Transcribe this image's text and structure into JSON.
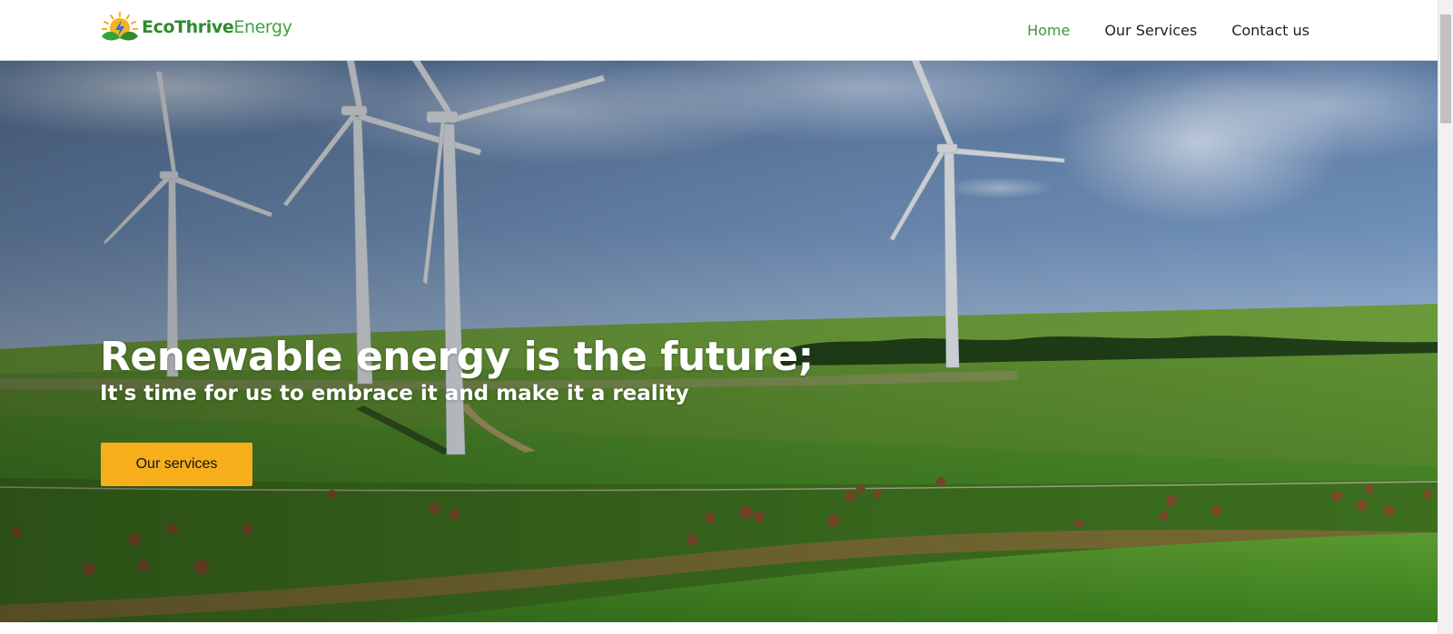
{
  "brand": {
    "name_bold": "EcoThrive",
    "name_light": "Energy",
    "colors": {
      "green": "#2e8b2e",
      "sun": "#f5b321",
      "bolt": "#2a6fd6"
    },
    "logo_icon": "sun-leaf-bolt-icon"
  },
  "nav": {
    "items": [
      {
        "label": "Home",
        "active": true
      },
      {
        "label": "Our Services",
        "active": false
      },
      {
        "label": "Contact us",
        "active": false
      }
    ],
    "active_color": "#3c9a3c"
  },
  "hero": {
    "title": "Renewable energy is the future;",
    "subtitle": "It's time for us to embrace it and make it a reality",
    "button_label": "Our services",
    "button_color": "#f7ae1b",
    "background_image": "wind-turbines-on-green-field"
  }
}
